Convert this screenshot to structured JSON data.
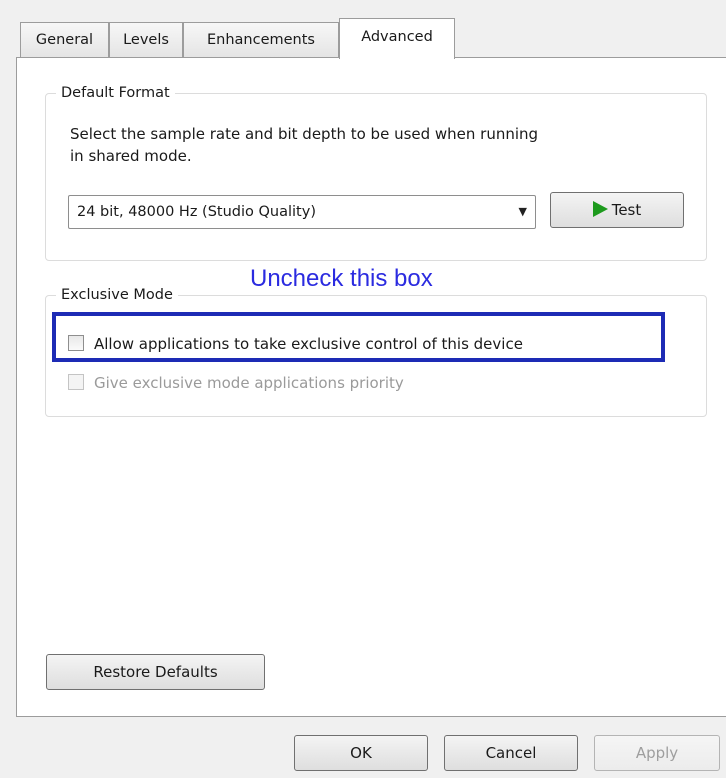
{
  "tabs": [
    {
      "label": "General",
      "active": false
    },
    {
      "label": "Levels",
      "active": false
    },
    {
      "label": "Enhancements",
      "active": false
    },
    {
      "label": "Advanced",
      "active": true
    }
  ],
  "default_format": {
    "title": "Default Format",
    "description_line1": "Select the sample rate and bit depth to be used when running",
    "description_line2": "in shared mode.",
    "selected_format": "24 bit, 48000 Hz (Studio Quality)",
    "test_label": "Test"
  },
  "exclusive_mode": {
    "title": "Exclusive Mode",
    "allow_exclusive": {
      "label": "Allow applications to take exclusive control of this device",
      "checked": false,
      "enabled": true
    },
    "give_priority": {
      "label": "Give exclusive mode applications priority",
      "checked": false,
      "enabled": false
    }
  },
  "annotation": {
    "text": "Uncheck this box",
    "color": "#1d2bb5"
  },
  "restore_defaults_label": "Restore Defaults",
  "footer": {
    "ok_label": "OK",
    "cancel_label": "Cancel",
    "apply_label": "Apply"
  },
  "colors": {
    "play_icon": "#1d9a1d",
    "annotation_text": "#2b2be0"
  }
}
